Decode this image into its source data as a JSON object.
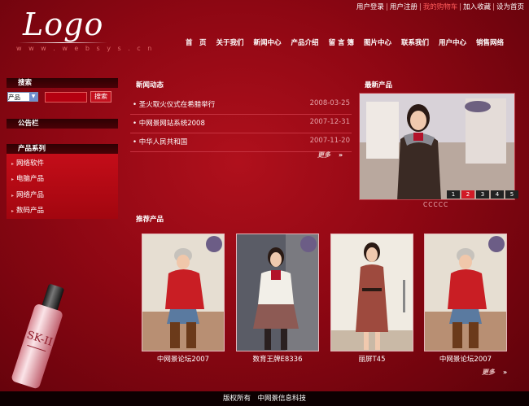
{
  "top_links": [
    "用户登录",
    "用户注册",
    "我的购物车",
    "加入收藏",
    "设为首页"
  ],
  "logo": {
    "text": "Logo",
    "url": "w w w . w e b s y s . c n"
  },
  "nav": [
    "首　页",
    "关于我们",
    "新闻中心",
    "产品介绍",
    "留 言 簿",
    "图片中心",
    "联系我们",
    "用户中心",
    "销售网络"
  ],
  "sidebar": {
    "search_title": "搜索",
    "search_select": "产品",
    "search_button": "搜索",
    "notice_title": "公告栏",
    "category_title": "产品系列",
    "categories": [
      "网络软件",
      "电脑产品",
      "网络产品",
      "数码产品"
    ]
  },
  "news": {
    "title": "新闻动态",
    "items": [
      {
        "title": "圣火取火仪式在希腊举行",
        "date": "2008-03-25"
      },
      {
        "title": "中网景网站系统2008",
        "date": "2007-12-31"
      },
      {
        "title": "中华人民共和国",
        "date": "2007-11-20"
      }
    ],
    "more": "更多"
  },
  "latest": {
    "title": "最新产品",
    "pages": [
      "1",
      "2",
      "3",
      "4",
      "5"
    ],
    "active_page": "2",
    "caption": "CCCCC"
  },
  "recommended": {
    "title": "推荐产品",
    "items": [
      "中网景论坛2007",
      "数育王牌E8336",
      "丽屏T45",
      "中网景论坛2007"
    ],
    "more": "更多"
  },
  "footer": "版权所有　中网景信息科技",
  "colors": {
    "background": "#8e0713",
    "accent": "#d21a26",
    "footer": "#0d0001"
  }
}
